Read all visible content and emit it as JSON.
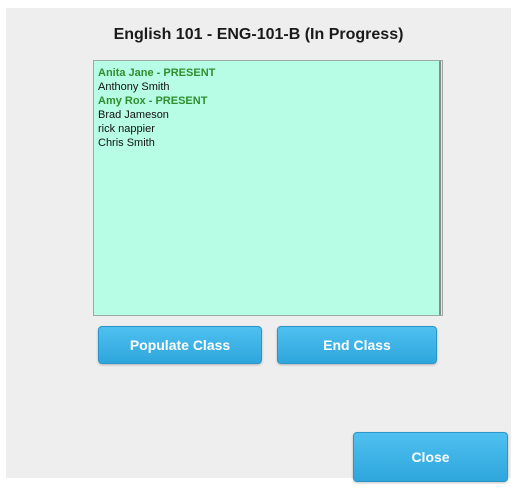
{
  "dialog": {
    "title": "English 101 - ENG-101-B (In Progress)"
  },
  "roster": {
    "items": [
      {
        "label": "Anita Jane - PRESENT",
        "present": true
      },
      {
        "label": "Anthony Smith",
        "present": false
      },
      {
        "label": "Amy Rox - PRESENT",
        "present": true
      },
      {
        "label": "Brad Jameson",
        "present": false
      },
      {
        "label": "rick nappier",
        "present": false
      },
      {
        "label": "Chris Smith",
        "present": false
      }
    ]
  },
  "actions": {
    "populate_label": "Populate Class",
    "end_label": "End Class",
    "close_label": "Close"
  },
  "colors": {
    "list_background": "#b7fce4",
    "present_text": "#2f8f2f",
    "button": "#3ab3e8",
    "dialog_background": "#eeeeee"
  }
}
